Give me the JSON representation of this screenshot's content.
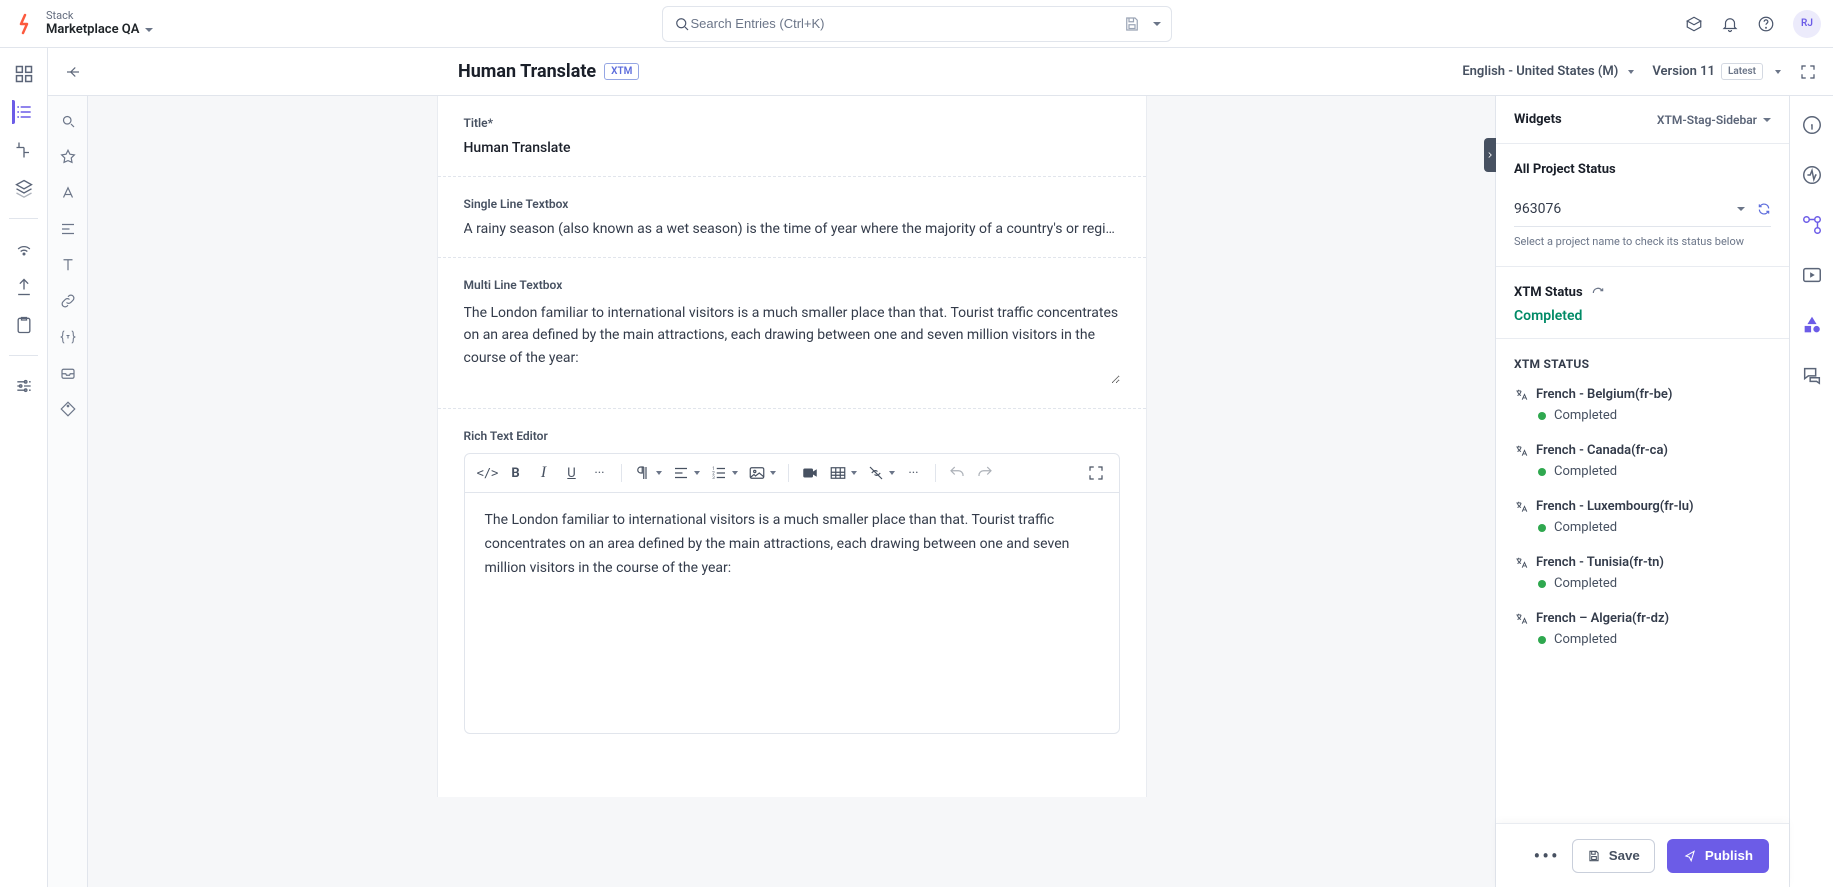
{
  "header": {
    "stack_label": "Stack",
    "stack_id": "Marketplace QA",
    "search_placeholder": "Search Entries (Ctrl+K)",
    "avatar_initials": "RJ"
  },
  "entry": {
    "back_tooltip": "Back",
    "title": "Human Translate",
    "title_pill": "XTM",
    "locale_label": "English - United States (M)",
    "version_label": "Version 11",
    "version_pill": "Latest"
  },
  "fields": {
    "title_label": "Title*",
    "title_value": "Human Translate",
    "slt_label": "Single Line Textbox",
    "slt_value": "A rainy season (also known as a wet season) is the time of year where the majority of a country's or region's ar",
    "mlt_label": "Multi Line Textbox",
    "mlt_value": "The London familiar to international visitors is a much smaller place than that. Tourist traffic concentrates on an area defined by the main attractions, each drawing between one and seven million visitors in the course of the year:",
    "rte_label": "Rich Text Editor",
    "rte_value": "The London familiar to international visitors is a much smaller place than that. Tourist traffic concentrates on an area defined by the main attractions, each drawing between one and seven million visitors in the course of the year:"
  },
  "rte_toolbar": {
    "code": "</>",
    "bold": "B",
    "italic": "I",
    "underline": "U",
    "more1": "···",
    "more2": "···"
  },
  "widgets": {
    "header": "Widgets",
    "selector": "XTM-Stag-Sidebar",
    "all_project_status": "All Project Status",
    "project_id": "963076",
    "project_hint": "Select a project name to check its status below",
    "xtm_status_label": "XTM Status",
    "xtm_status_value": "Completed",
    "lang_section_title": "XTM STATUS",
    "languages": [
      {
        "name": "French - Belgium(fr-be)",
        "status": "Completed"
      },
      {
        "name": "French - Canada(fr-ca)",
        "status": "Completed"
      },
      {
        "name": "French - Luxembourg(fr-lu)",
        "status": "Completed"
      },
      {
        "name": "French - Tunisia(fr-tn)",
        "status": "Completed"
      },
      {
        "name": "French – Algeria(fr-dz)",
        "status": "Completed"
      }
    ]
  },
  "footer": {
    "save": "Save",
    "publish": "Publish"
  }
}
